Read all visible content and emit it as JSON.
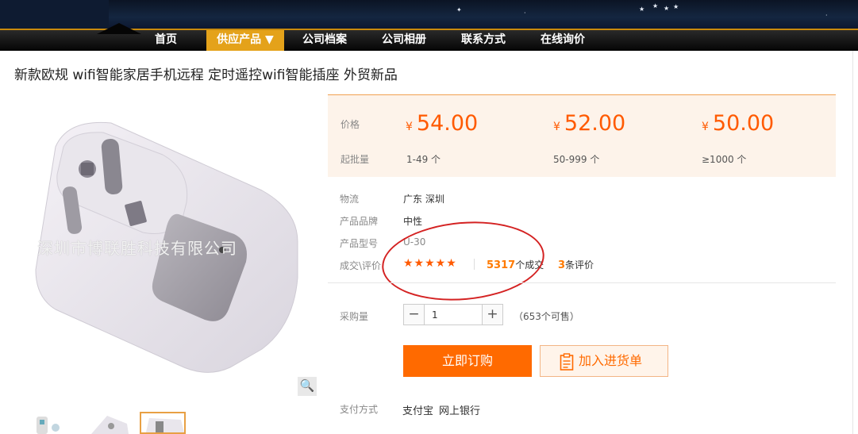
{
  "nav": {
    "items": [
      {
        "label": "首页"
      },
      {
        "label": "供应产品 ▼",
        "active": true
      },
      {
        "label": "公司档案"
      },
      {
        "label": "公司相册"
      },
      {
        "label": "联系方式"
      },
      {
        "label": "在线询价"
      }
    ]
  },
  "product": {
    "title": "新款欧规 wifi智能家居手机远程 定时遥控wifi智能插座 外贸新品",
    "watermark": "深圳市博联胜科技有限公司"
  },
  "pricing": {
    "price_label": "价格",
    "moq_label": "起批量",
    "currency": "¥",
    "tiers": [
      {
        "price": "54.00",
        "range": "1-49 个"
      },
      {
        "price": "52.00",
        "range": "50-999 个"
      },
      {
        "price": "50.00",
        "range": "≥1000 个"
      }
    ]
  },
  "info": {
    "logistics_label": "物流",
    "logistics_value": "广东 深圳",
    "brand_label": "产品品牌",
    "brand_value": "中性",
    "model_label": "产品型号",
    "model_value": "U-30",
    "deal_label": "成交\\评价",
    "rating_stars": 5,
    "stars_text": "★★★★★",
    "deal_count": "5317",
    "deal_suffix": "个成交",
    "review_count": "3",
    "review_suffix": "条评价"
  },
  "purchase": {
    "qty_label": "采购量",
    "qty_value": "1",
    "minus": "−",
    "plus": "+",
    "available": "（653个可售）",
    "buy_label": "立即订购",
    "cart_label": "加入进货单"
  },
  "payment": {
    "label": "支付方式",
    "methods": [
      "支付宝",
      "网上银行"
    ]
  },
  "colors": {
    "accent": "#ff6a00",
    "nav_active": "#e4a21a",
    "annotation": "#d42222"
  }
}
